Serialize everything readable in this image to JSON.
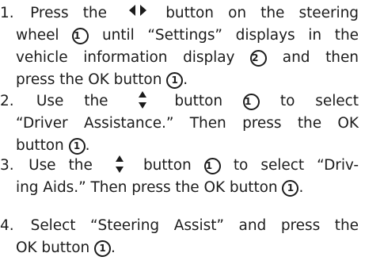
{
  "steps": [
    {
      "number": "1.",
      "lines": [
        [
          "Press the",
          "button on the steering"
        ],
        [
          "wheel",
          "until “Settings” displays in the"
        ],
        [
          "vehicle information display",
          "and then"
        ],
        [
          "press the OK button",
          "."
        ]
      ]
    },
    {
      "number": "2.",
      "lines": [
        [
          "Use the",
          "button",
          "to select"
        ],
        [
          "“Driver Assistance.” Then press the OK"
        ],
        [
          "button",
          "."
        ]
      ]
    },
    {
      "number": "3.",
      "lines": [
        [
          "Use the",
          "button",
          "to select “Driv-"
        ],
        [
          "ing Aids.” Then press the OK button",
          "."
        ]
      ]
    },
    {
      "number": "4.",
      "lines": [
        [
          "Select “Steering Assist” and press the"
        ],
        [
          "OK button",
          "."
        ]
      ]
    }
  ],
  "callouts": {
    "button": "1",
    "display": "2"
  },
  "icons": {
    "left_right_button": "left-right-arrows-icon",
    "up_down_button": "up-down-arrows-icon"
  }
}
